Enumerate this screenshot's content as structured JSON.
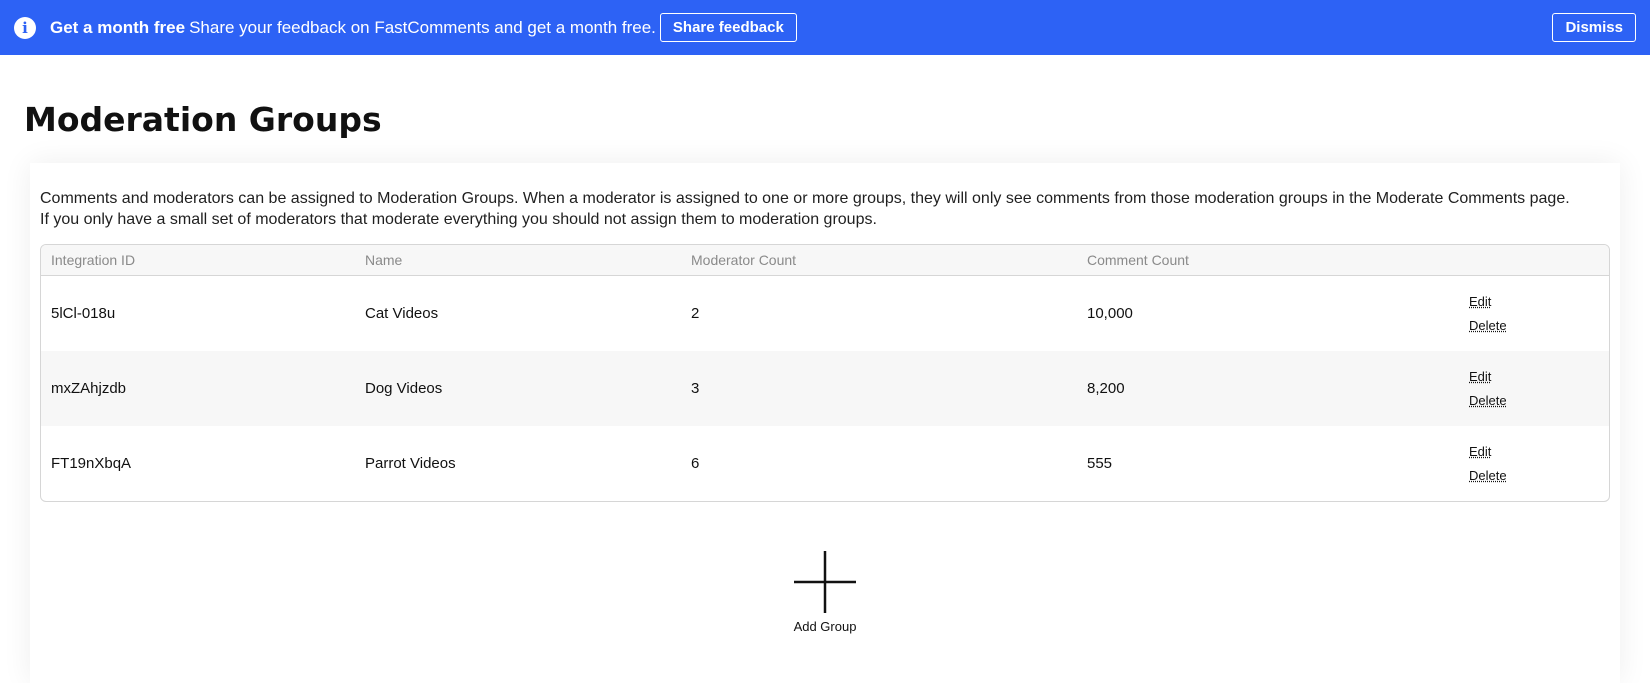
{
  "banner": {
    "title": "Get a month free",
    "message": "Share your feedback on FastComments and get a month free.",
    "share_label": "Share feedback",
    "dismiss_label": "Dismiss",
    "info_icon": "info-icon",
    "color": "#2d62f5"
  },
  "page": {
    "title": "Moderation Groups",
    "description": "Comments and moderators can be assigned to Moderation Groups. When a moderator is assigned to one or more groups, they will only see comments from those moderation groups in the Moderate Comments page. If you only have a small set of moderators that moderate everything you should not assign them to moderation groups."
  },
  "table": {
    "columns": [
      "Integration ID",
      "Name",
      "Moderator Count",
      "Comment Count"
    ],
    "edit_label": "Edit",
    "delete_label": "Delete",
    "rows": [
      {
        "integration_id": "5lCl-018u",
        "name": "Cat Videos",
        "moderator_count": "2",
        "comment_count": "10,000"
      },
      {
        "integration_id": "mxZAhjzdb",
        "name": "Dog Videos",
        "moderator_count": "3",
        "comment_count": "8,200"
      },
      {
        "integration_id": "FT19nXbqA",
        "name": "Parrot Videos",
        "moderator_count": "6",
        "comment_count": "555"
      }
    ]
  },
  "add_group": {
    "label": "Add Group",
    "icon": "plus-icon"
  }
}
